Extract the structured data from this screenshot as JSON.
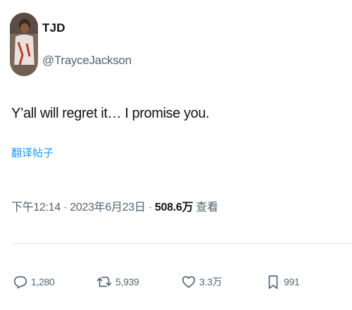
{
  "author": {
    "display_name": "TJD",
    "handle": "@TrayceJackson"
  },
  "tweet": {
    "text": "Y’all will regret it… I promise you.",
    "translate_label": "翻译帖子"
  },
  "meta": {
    "time": "下午12:14",
    "separator1": " · ",
    "date": "2023年6月23日",
    "separator2": " · ",
    "views_count": "508.6万",
    "views_label": " 查看"
  },
  "actions": {
    "reply_count": "1,280",
    "retweet_count": "5,939",
    "like_count": "3.3万",
    "bookmark_count": "991"
  },
  "icons": {
    "reply": "reply-icon",
    "retweet": "retweet-icon",
    "like": "heart-icon",
    "bookmark": "bookmark-icon"
  },
  "colors": {
    "text": "#0f1419",
    "secondary": "#536471",
    "link": "#1d9bf0",
    "divider": "#e6ecf0"
  }
}
